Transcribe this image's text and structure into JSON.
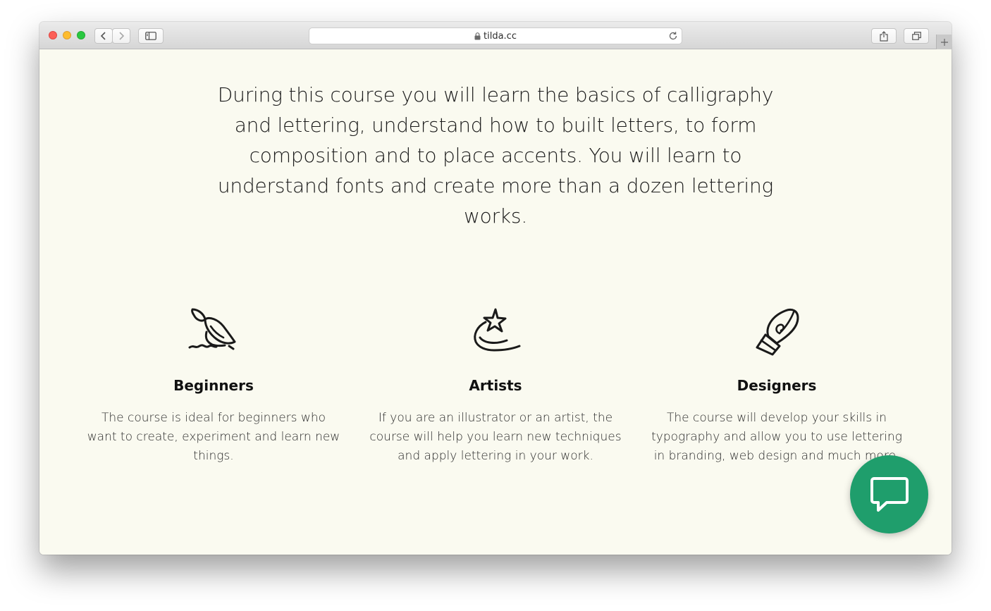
{
  "browser": {
    "url": "tilda.cc",
    "colors": {
      "close": "#fc5f57",
      "minimize": "#fdbc2e",
      "maximize": "#28c840"
    }
  },
  "intro_text": "During this course you will learn the basics of calligraphy and lettering, understand how to built letters, to form composition and to place accents. You will learn to understand fonts and create more than a dozen lettering works.",
  "audiences": [
    {
      "icon": "brush-icon",
      "title": "Beginners",
      "text": "The course is ideal for beginners who want to create, experiment and learn new things."
    },
    {
      "icon": "star-icon",
      "title": "Artists",
      "text": "If you are an illustrator or an artist, the course will help you learn new techniques and apply lettering in your work."
    },
    {
      "icon": "pen-nib-icon",
      "title": "Designers",
      "text": "The course will develop your skills in typography and allow you to use lettering in branding, web design and much more."
    }
  ],
  "chat_widget": {
    "icon": "chat-bubble-icon",
    "color": "#1f9e6c"
  },
  "colors": {
    "page_background": "#fafaf0",
    "text": "#1a1a1a"
  }
}
